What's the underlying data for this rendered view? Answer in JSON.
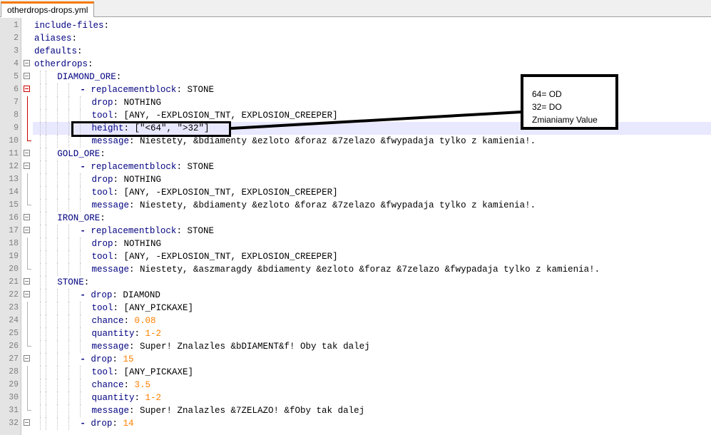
{
  "tab": {
    "label": "otherdrops-drops.yml"
  },
  "callout": {
    "lines": [
      "64= OD",
      "32= DO",
      "Zmianiamy Value"
    ]
  },
  "editor": {
    "current_line": 9,
    "lines": [
      {
        "n": "1",
        "indent": 0,
        "fold": "none",
        "tokens": [
          {
            "t": "include-files",
            "c": "key"
          },
          {
            "t": ":",
            "c": "val"
          }
        ]
      },
      {
        "n": "2",
        "indent": 0,
        "fold": "none",
        "tokens": [
          {
            "t": "aliases",
            "c": "key"
          },
          {
            "t": ":",
            "c": "val"
          }
        ]
      },
      {
        "n": "3",
        "indent": 0,
        "fold": "none",
        "tokens": [
          {
            "t": "defaults",
            "c": "key"
          },
          {
            "t": ":",
            "c": "val"
          }
        ]
      },
      {
        "n": "4",
        "indent": 0,
        "fold": "open",
        "tokens": [
          {
            "t": "otherdrops",
            "c": "key"
          },
          {
            "t": ":",
            "c": "val"
          }
        ]
      },
      {
        "n": "5",
        "indent": 4,
        "fold": "open",
        "tokens": [
          {
            "t": "DIAMOND_ORE",
            "c": "key"
          },
          {
            "t": ":",
            "c": "val"
          }
        ]
      },
      {
        "n": "6",
        "indent": 8,
        "fold": "openred",
        "tokens": [
          {
            "t": "- ",
            "c": "dash"
          },
          {
            "t": "replacementblock",
            "c": "key"
          },
          {
            "t": ": STONE",
            "c": "val"
          }
        ]
      },
      {
        "n": "7",
        "indent": 10,
        "fold": "linered",
        "tokens": [
          {
            "t": "drop",
            "c": "key"
          },
          {
            "t": ": NOTHING",
            "c": "val"
          }
        ]
      },
      {
        "n": "8",
        "indent": 10,
        "fold": "linered",
        "tokens": [
          {
            "t": "tool",
            "c": "key"
          },
          {
            "t": ": [ANY, -EXPLOSION_TNT, EXPLOSION_CREEPER]",
            "c": "val"
          }
        ]
      },
      {
        "n": "9",
        "indent": 10,
        "fold": "linered",
        "tokens": [
          {
            "t": "height",
            "c": "key"
          },
          {
            "t": ": [\"<64\", \">32\"]",
            "c": "val"
          }
        ]
      },
      {
        "n": "10",
        "indent": 10,
        "fold": "endred",
        "tokens": [
          {
            "t": "message",
            "c": "key"
          },
          {
            "t": ": Niestety, &bdiamenty &ezloto &foraz &7zelazo &fwypadaja tylko z kamienia!.",
            "c": "val"
          }
        ]
      },
      {
        "n": "11",
        "indent": 4,
        "fold": "open",
        "tokens": [
          {
            "t": "GOLD_ORE",
            "c": "key"
          },
          {
            "t": ":",
            "c": "val"
          }
        ]
      },
      {
        "n": "12",
        "indent": 8,
        "fold": "open",
        "tokens": [
          {
            "t": "- ",
            "c": "dash"
          },
          {
            "t": "replacementblock",
            "c": "key"
          },
          {
            "t": ": STONE",
            "c": "val"
          }
        ]
      },
      {
        "n": "13",
        "indent": 10,
        "fold": "line",
        "tokens": [
          {
            "t": "drop",
            "c": "key"
          },
          {
            "t": ": NOTHING",
            "c": "val"
          }
        ]
      },
      {
        "n": "14",
        "indent": 10,
        "fold": "line",
        "tokens": [
          {
            "t": "tool",
            "c": "key"
          },
          {
            "t": ": [ANY, -EXPLOSION_TNT, EXPLOSION_CREEPER]",
            "c": "val"
          }
        ]
      },
      {
        "n": "15",
        "indent": 10,
        "fold": "end",
        "tokens": [
          {
            "t": "message",
            "c": "key"
          },
          {
            "t": ": Niestety, &bdiamenty &ezloto &foraz &7zelazo &fwypadaja tylko z kamienia!.",
            "c": "val"
          }
        ]
      },
      {
        "n": "16",
        "indent": 4,
        "fold": "open",
        "tokens": [
          {
            "t": "IRON_ORE",
            "c": "key"
          },
          {
            "t": ":",
            "c": "val"
          }
        ]
      },
      {
        "n": "17",
        "indent": 8,
        "fold": "open",
        "tokens": [
          {
            "t": "- ",
            "c": "dash"
          },
          {
            "t": "replacementblock",
            "c": "key"
          },
          {
            "t": ": STONE",
            "c": "val"
          }
        ]
      },
      {
        "n": "18",
        "indent": 10,
        "fold": "line",
        "tokens": [
          {
            "t": "drop",
            "c": "key"
          },
          {
            "t": ": NOTHING",
            "c": "val"
          }
        ]
      },
      {
        "n": "19",
        "indent": 10,
        "fold": "line",
        "tokens": [
          {
            "t": "tool",
            "c": "key"
          },
          {
            "t": ": [ANY, -EXPLOSION_TNT, EXPLOSION_CREEPER]",
            "c": "val"
          }
        ]
      },
      {
        "n": "20",
        "indent": 10,
        "fold": "end",
        "tokens": [
          {
            "t": "message",
            "c": "key"
          },
          {
            "t": ": Niestety, &aszmaragdy &bdiamenty &ezloto &foraz &7zelazo &fwypadaja tylko z kamienia!.",
            "c": "val"
          }
        ]
      },
      {
        "n": "21",
        "indent": 4,
        "fold": "open",
        "tokens": [
          {
            "t": "STONE",
            "c": "key"
          },
          {
            "t": ":",
            "c": "val"
          }
        ]
      },
      {
        "n": "22",
        "indent": 8,
        "fold": "open",
        "tokens": [
          {
            "t": "- ",
            "c": "dash"
          },
          {
            "t": "drop",
            "c": "key"
          },
          {
            "t": ": DIAMOND",
            "c": "val"
          }
        ]
      },
      {
        "n": "23",
        "indent": 10,
        "fold": "line",
        "tokens": [
          {
            "t": "tool",
            "c": "key"
          },
          {
            "t": ": [ANY_PICKAXE]",
            "c": "val"
          }
        ]
      },
      {
        "n": "24",
        "indent": 10,
        "fold": "line",
        "tokens": [
          {
            "t": "chance",
            "c": "key"
          },
          {
            "t": ": ",
            "c": "val"
          },
          {
            "t": "0.08",
            "c": "num"
          }
        ]
      },
      {
        "n": "25",
        "indent": 10,
        "fold": "line",
        "tokens": [
          {
            "t": "quantity",
            "c": "key"
          },
          {
            "t": ": ",
            "c": "val"
          },
          {
            "t": "1-2",
            "c": "num"
          }
        ]
      },
      {
        "n": "26",
        "indent": 10,
        "fold": "end",
        "tokens": [
          {
            "t": "message",
            "c": "key"
          },
          {
            "t": ": Super! Znalazles &bDIAMENT&f! Oby tak dalej",
            "c": "val"
          }
        ]
      },
      {
        "n": "27",
        "indent": 8,
        "fold": "open",
        "tokens": [
          {
            "t": "- ",
            "c": "dash"
          },
          {
            "t": "drop",
            "c": "key"
          },
          {
            "t": ": ",
            "c": "val"
          },
          {
            "t": "15",
            "c": "num"
          }
        ]
      },
      {
        "n": "28",
        "indent": 10,
        "fold": "line",
        "tokens": [
          {
            "t": "tool",
            "c": "key"
          },
          {
            "t": ": [ANY_PICKAXE]",
            "c": "val"
          }
        ]
      },
      {
        "n": "29",
        "indent": 10,
        "fold": "line",
        "tokens": [
          {
            "t": "chance",
            "c": "key"
          },
          {
            "t": ": ",
            "c": "val"
          },
          {
            "t": "3.5",
            "c": "num"
          }
        ]
      },
      {
        "n": "30",
        "indent": 10,
        "fold": "line",
        "tokens": [
          {
            "t": "quantity",
            "c": "key"
          },
          {
            "t": ": ",
            "c": "val"
          },
          {
            "t": "1-2",
            "c": "num"
          }
        ]
      },
      {
        "n": "31",
        "indent": 10,
        "fold": "end",
        "tokens": [
          {
            "t": "message",
            "c": "key"
          },
          {
            "t": ": Super! Znalazles &7ZELAZO! &fOby tak dalej",
            "c": "val"
          }
        ]
      },
      {
        "n": "32",
        "indent": 8,
        "fold": "open",
        "tokens": [
          {
            "t": "- ",
            "c": "dash"
          },
          {
            "t": "drop",
            "c": "key"
          },
          {
            "t": ": ",
            "c": "val"
          },
          {
            "t": "14",
            "c": "num"
          }
        ]
      }
    ]
  }
}
